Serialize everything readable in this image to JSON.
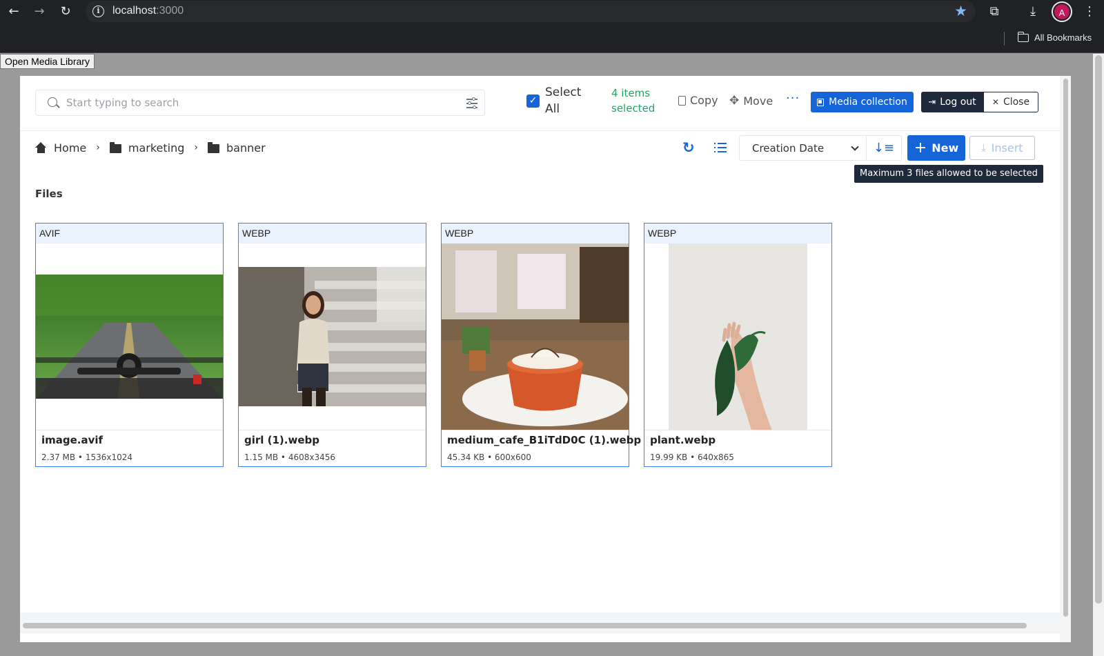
{
  "browser": {
    "url_host": "localhost",
    "url_port": ":3000",
    "avatar_initial": "A",
    "bookmarks_folder": "All Bookmarks"
  },
  "page": {
    "open_library_button": "Open Media Library"
  },
  "toolbar": {
    "search_placeholder": "Start typing to search",
    "select_all_label": "Select All",
    "selected_count": "4 items selected",
    "copy_label": "Copy",
    "move_label": "Move",
    "more_label": "···",
    "media_collection_label": "Media collection",
    "logout_label": "Log out",
    "close_label": "Close"
  },
  "breadcrumb": {
    "items": [
      "Home",
      "marketing",
      "banner"
    ]
  },
  "controls": {
    "sort_value": "Creation Date",
    "new_label": "New",
    "insert_label": "Insert",
    "tooltip": "Maximum 3 files allowed to be selected"
  },
  "files_section_title": "Files",
  "files": [
    {
      "type": "AVIF",
      "name": "image.avif",
      "meta": "2.37 MB • 1536x1024",
      "thumb": "motorcycle-road"
    },
    {
      "type": "WEBP",
      "name": "girl (1).webp",
      "meta": "1.15 MB • 4608x3456",
      "thumb": "girl-on-stairs"
    },
    {
      "type": "WEBP",
      "name": "medium_cafe_B1iTdD0C (1).webp",
      "meta": "45.34 KB • 600x600",
      "thumb": "cafe-dessert"
    },
    {
      "type": "WEBP",
      "name": "plant.webp",
      "meta": "19.99 KB • 640x865",
      "thumb": "hand-holding-plant"
    }
  ],
  "colors": {
    "primary": "#1565d8",
    "selected_text": "#1fa56a",
    "dark_button": "#1e2a3b",
    "card_border": "#3b82f6"
  }
}
